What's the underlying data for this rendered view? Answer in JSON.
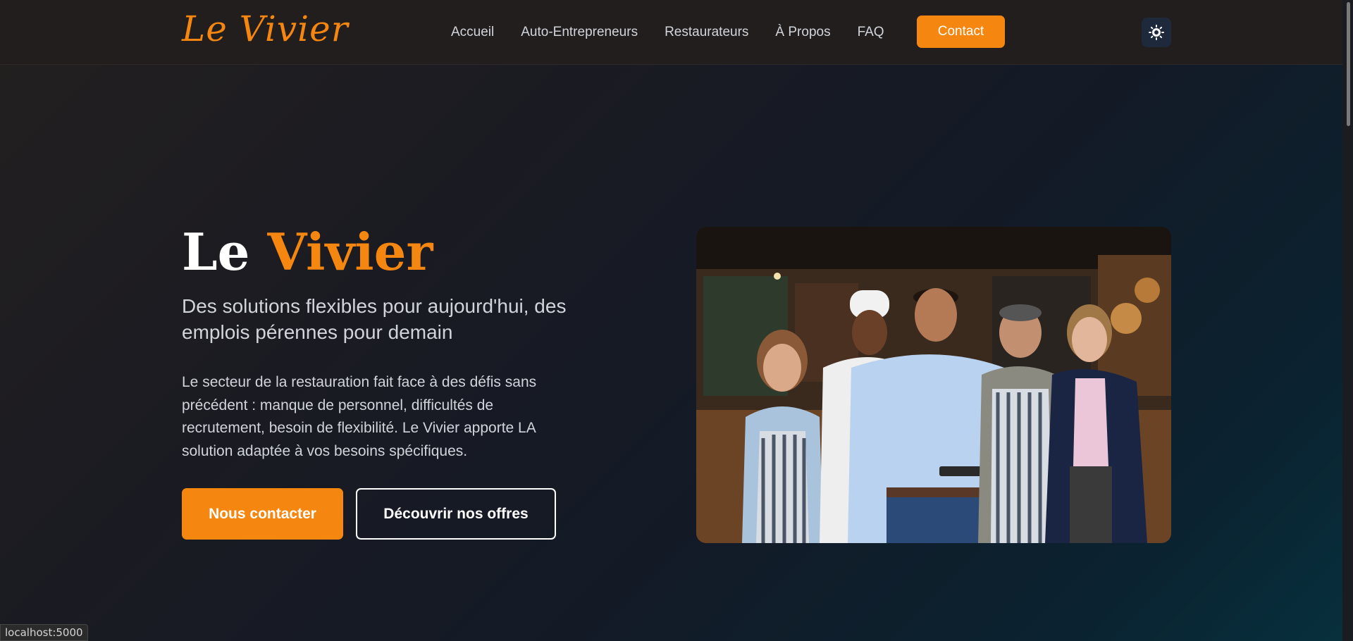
{
  "header": {
    "logo_text": "Le Vivier",
    "nav_items": [
      {
        "label": "Accueil"
      },
      {
        "label": "Auto-Entrepreneurs"
      },
      {
        "label": "Restaurateurs"
      },
      {
        "label": "À Propos"
      },
      {
        "label": "FAQ"
      }
    ],
    "contact_label": "Contact",
    "theme_toggle_icon": "sun-icon"
  },
  "hero": {
    "title_part1": "Le ",
    "title_part2": "Vivier",
    "subtitle": "Des solutions flexibles pour aujourd'hui, des emplois pérennes pour demain",
    "description": "Le secteur de la restauration fait face à des défis sans précédent : manque de personnel, difficultés de recrutement, besoin de flexibilité. Le Vivier apporte LA solution adaptée à vos besoins spécifiques.",
    "primary_button": "Nous contacter",
    "secondary_button": "Découvrir nos offres"
  },
  "status_bar": {
    "url": "localhost:5000"
  },
  "colors": {
    "accent": "#f5860f",
    "header_bg": "#221e1e",
    "theme_toggle_bg": "#1e293b"
  }
}
